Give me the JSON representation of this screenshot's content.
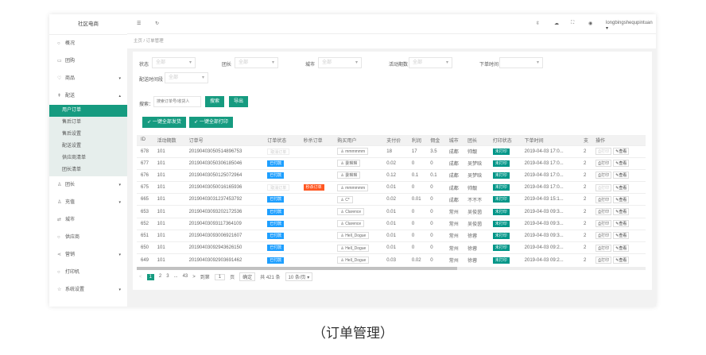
{
  "app": {
    "title": "社区电商",
    "user": "longbingshequpintuan"
  },
  "sidebar": [
    {
      "icon": "○",
      "label": "概况"
    },
    {
      "icon": "▭",
      "label": "团购"
    },
    {
      "icon": "♡",
      "label": "商品",
      "arrow": "▾"
    },
    {
      "icon": "⇞",
      "label": "配送",
      "arrow": "▴"
    }
  ],
  "submenu": [
    "用户订单",
    "售后订单",
    "售后设置",
    "配送设置",
    "供应商清单",
    "团长清单"
  ],
  "sidebar2": [
    {
      "icon": "♙",
      "label": "团长",
      "arrow": "▾"
    },
    {
      "icon": "♙",
      "label": "充值",
      "arrow": "▾"
    },
    {
      "icon": "⇄",
      "label": "城市"
    },
    {
      "icon": "○",
      "label": "供应商"
    },
    {
      "icon": "⋖",
      "label": "营销",
      "arrow": "▾"
    },
    {
      "icon": "○",
      "label": "打印机"
    },
    {
      "icon": "☆",
      "label": "系统设置",
      "arrow": "▾"
    }
  ],
  "breadcrumb": {
    "home": "主页",
    "sep": "/",
    "current": "订单管理"
  },
  "filters": {
    "status": "状态",
    "team": "团长",
    "city": "城市",
    "period": "活动期数",
    "time": "下单时间",
    "slot": "配送时间段",
    "all": "全部"
  },
  "search": {
    "label": "搜索：",
    "placeholder": "搜索订单号/收货人",
    "search": "搜索",
    "export": "导出"
  },
  "actions": {
    "ship": "一键全部发货",
    "print": "一键全部打印"
  },
  "columns": [
    "ID",
    "活动期数",
    "订单号",
    "订单状态",
    "秒杀订单",
    "购买用户",
    "支付价",
    "利润",
    "佣金",
    "城市",
    "团长",
    "打印状态",
    "下单时间",
    "支",
    "操作"
  ],
  "rows": [
    [
      "678",
      "101",
      "2019040305051489675​3",
      "取消订单",
      "",
      "mmmmmm",
      "18",
      "17",
      "3.5",
      "成都",
      "帅靓",
      "未打印",
      "2019-04-03 17:0...",
      "2"
    ],
    [
      "677",
      "101",
      "20190403050306185046",
      "已付款",
      "",
      "委琳琳",
      "0.02",
      "0",
      "0",
      "成都",
      "吴梦晗",
      "未打印",
      "2019-04-03 17:0...",
      "2"
    ],
    [
      "676",
      "101",
      "20190403050125072964",
      "已付款",
      "",
      "委琳琳",
      "0.12",
      "0.1",
      "0.1",
      "成都",
      "吴梦晗",
      "未打印",
      "2019-04-03 17:0...",
      "2"
    ],
    [
      "675",
      "101",
      "20190403050016165936",
      "取消订单",
      "秒杀订单",
      "mmmmmm",
      "0.01",
      "0",
      "0",
      "成都",
      "帅靓",
      "未打印",
      "2019-04-03 17:0...",
      "2"
    ],
    [
      "665",
      "101",
      "20190403031237453792",
      "已付款",
      "",
      "C*",
      "0.02",
      "0.01",
      "0",
      "成都",
      "不不不",
      "未打印",
      "2019-04-03 15:1...",
      "2"
    ],
    [
      "653",
      "101",
      "20190403093202172536",
      "已付款",
      "",
      "Clarence",
      "0.01",
      "0",
      "0",
      "常州",
      "吴俊茵",
      "未打印",
      "2019-04-03 09:3...",
      "2"
    ],
    [
      "652",
      "101",
      "20190403093117364109",
      "已付款",
      "",
      "Clarence",
      "0.01",
      "0",
      "0",
      "常州",
      "吴俊茵",
      "未打印",
      "2019-04-03 09:3...",
      "2"
    ],
    [
      "651",
      "101",
      "20190403093006921607",
      "已付款",
      "",
      "Hell_Dogue",
      "0.01",
      "0",
      "0",
      "常州",
      "徐蓉",
      "未打印",
      "2019-04-03 09:3...",
      "2"
    ],
    [
      "650",
      "101",
      "20190403092943626150",
      "已付款",
      "",
      "Hell_Dogue",
      "0.01",
      "0",
      "0",
      "常州",
      "徐蓉",
      "未打印",
      "2019-04-03 09:2...",
      "2"
    ],
    [
      "649",
      "101",
      "20190403092903691462",
      "已付款",
      "",
      "Hell_Dogue",
      "0.03",
      "0.02",
      "0",
      "常州",
      "徐蓉",
      "未打印",
      "2019-04-03 09:2...",
      "2"
    ]
  ],
  "ops": {
    "print": "打印",
    "view": "查看"
  },
  "pagination": {
    "prev": "<",
    "pages": [
      "1",
      "2",
      "3",
      "...",
      "43"
    ],
    "next": ">",
    "goto": "到第",
    "page": "1",
    "unit": "页",
    "confirm": "确定",
    "total": "共 421 条",
    "size": "10 条/页"
  },
  "caption": "（订单管理）",
  "colors": {
    "accent": "#169b80",
    "paid": "#1e9fff",
    "flash": "#ff5722"
  }
}
